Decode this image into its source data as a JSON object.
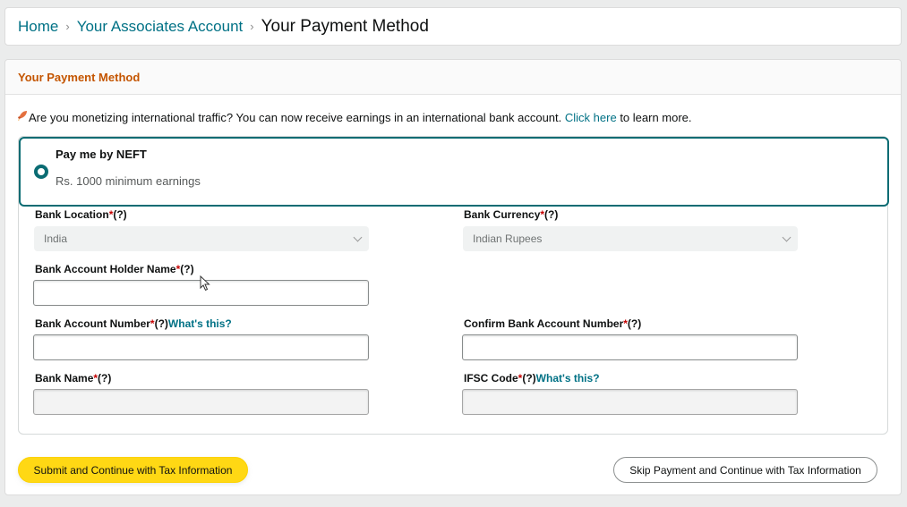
{
  "breadcrumb": {
    "home": "Home",
    "sep": "›",
    "associates": "Your Associates Account",
    "current": "Your Payment Method"
  },
  "panel": {
    "title": "Your Payment Method"
  },
  "notice": {
    "icon": "rocket-icon",
    "text_before": "Are you monetizing international traffic? You can now receive earnings in an international bank account.",
    "link": "Click here",
    "text_after": "to learn more."
  },
  "method": {
    "title": "Pay me by NEFT",
    "subtitle": "Rs. 1000 minimum earnings",
    "selected": true
  },
  "form": {
    "bank_location": {
      "label": "Bank Location",
      "req": "*",
      "help": "(?)",
      "value": "India"
    },
    "bank_currency": {
      "label": "Bank Currency",
      "req": "*",
      "help": "(?)",
      "value": "Indian Rupees"
    },
    "holder_name": {
      "label": "Bank Account Holder Name",
      "req": "*",
      "help": "(?)",
      "value": ""
    },
    "account_number": {
      "label": "Bank Account Number",
      "req": "*",
      "help": "(?)",
      "whats": "What's this?",
      "value": ""
    },
    "confirm_account": {
      "label": "Confirm Bank Account Number",
      "req": "*",
      "help": "(?)",
      "value": ""
    },
    "bank_name": {
      "label": "Bank Name",
      "req": "*",
      "help": "(?)",
      "value": ""
    },
    "ifsc": {
      "label": "IFSC Code",
      "req": "*",
      "help": "(?)",
      "whats": "What's this?",
      "value": ""
    }
  },
  "buttons": {
    "submit": "Submit and Continue with Tax Information",
    "skip": "Skip Payment and Continue with Tax Information"
  },
  "colors": {
    "accent_teal": "#0a6c73",
    "link": "#007185",
    "panel_title": "#c45500",
    "primary_button": "#ffd814"
  }
}
